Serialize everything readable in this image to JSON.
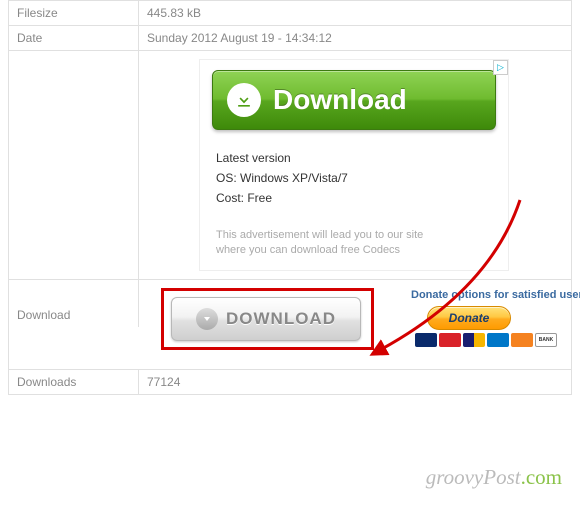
{
  "rows": {
    "filesize": {
      "label": "Filesize",
      "value": "445.83 kB"
    },
    "date": {
      "label": "Date",
      "value": "Sunday 2012 August 19 - 14:34:12"
    },
    "download": {
      "label": "Download"
    },
    "downloads": {
      "label": "Downloads",
      "value": "77124"
    }
  },
  "ad": {
    "button_text": "Download",
    "latest": "Latest version",
    "os": "OS: Windows XP/Vista/7",
    "cost": "Cost: Free",
    "footer1": "This advertisement will lead you to our site",
    "footer2": "where you can download free Codecs",
    "adchoices": "▷"
  },
  "gray_button": "DOWNLOAD",
  "donate": {
    "title": "Donate options for satisfied users:",
    "button": "Donate"
  },
  "watermark": {
    "a": "groovy",
    "b": "Post",
    "c": ".com"
  }
}
